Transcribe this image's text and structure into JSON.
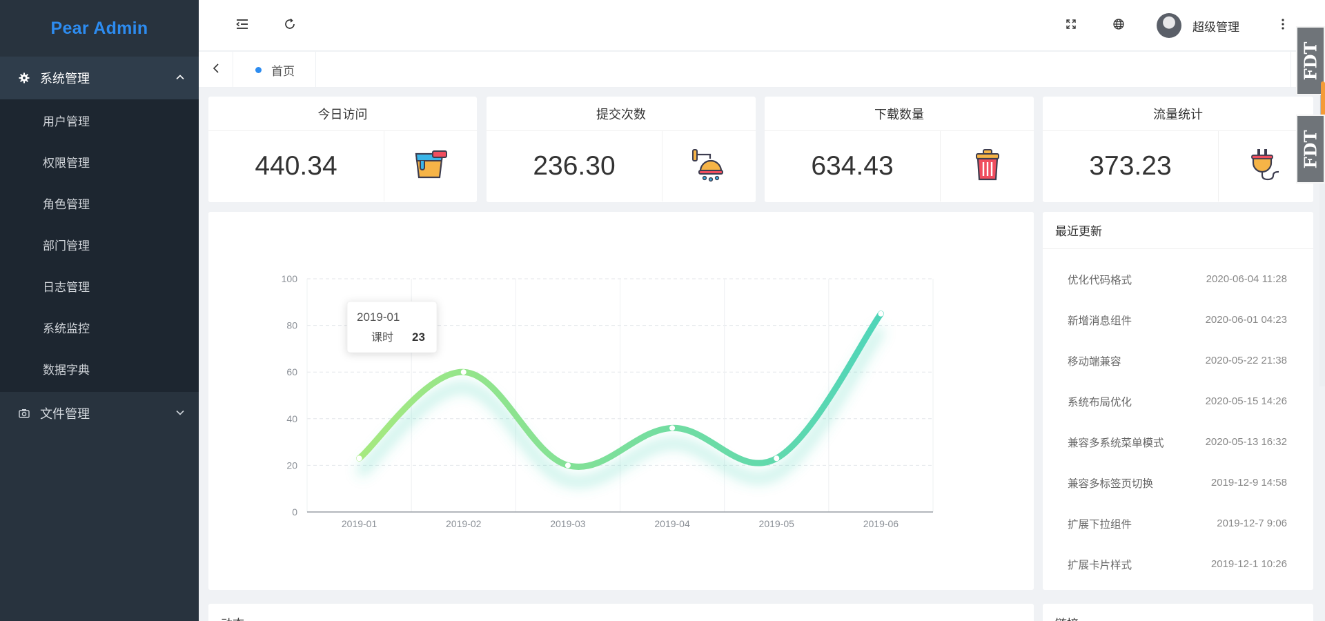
{
  "app": {
    "logo": "Pear Admin"
  },
  "sidebar": {
    "system_menu_label": "系统管理",
    "items": [
      {
        "label": "用户管理"
      },
      {
        "label": "权限管理"
      },
      {
        "label": "角色管理"
      },
      {
        "label": "部门管理"
      },
      {
        "label": "日志管理"
      },
      {
        "label": "系统监控"
      },
      {
        "label": "数据字典"
      }
    ],
    "file_menu_label": "文件管理"
  },
  "header": {
    "user_name": "超级管理",
    "icons": [
      "menu-fold-icon",
      "refresh-icon",
      "fullscreen-icon",
      "globe-icon",
      "more-icon"
    ]
  },
  "tabs": {
    "home_label": "首页",
    "active_color": "#2d8cf0"
  },
  "stats": [
    {
      "title": "今日访问",
      "value": "440.34",
      "icon": "paint-bucket-icon"
    },
    {
      "title": "提交次数",
      "value": "236.30",
      "icon": "shower-icon"
    },
    {
      "title": "下载数量",
      "value": "634.43",
      "icon": "trash-bin-icon"
    },
    {
      "title": "流量统计",
      "value": "373.23",
      "icon": "plug-icon"
    }
  ],
  "chart_data": {
    "type": "line",
    "categories": [
      "2019-01",
      "2019-02",
      "2019-03",
      "2019-04",
      "2019-05",
      "2019-06"
    ],
    "series": [
      {
        "name": "课时",
        "values": [
          23,
          60,
          20,
          36,
          23,
          85
        ]
      }
    ],
    "ylim": [
      0,
      100
    ],
    "yticks": [
      0,
      20,
      40,
      60,
      80,
      100
    ],
    "smooth": true,
    "grid": true,
    "colors": [
      "#a6e97f",
      "#4fd5b9"
    ],
    "tooltip": {
      "category": "2019-01",
      "series_label": "课时",
      "value": "23"
    }
  },
  "updates": {
    "title": "最近更新",
    "items": [
      {
        "text": "优化代码格式",
        "time": "2020-06-04 11:28"
      },
      {
        "text": "新增消息组件",
        "time": "2020-06-01 04:23"
      },
      {
        "text": "移动端兼容",
        "time": "2020-05-22 21:38"
      },
      {
        "text": "系统布局优化",
        "time": "2020-05-15 14:26"
      },
      {
        "text": "兼容多系统菜单模式",
        "time": "2020-05-13 16:32"
      },
      {
        "text": "兼容多标签页切换",
        "time": "2019-12-9 14:58"
      },
      {
        "text": "扩展下拉组件",
        "time": "2019-12-7 9:06"
      },
      {
        "text": "扩展卡片样式",
        "time": "2019-12-1 10:26"
      }
    ]
  },
  "bottom": {
    "left_title": "动态",
    "right_title": "链接"
  },
  "widgets": {
    "fdt_label": "FDT"
  }
}
